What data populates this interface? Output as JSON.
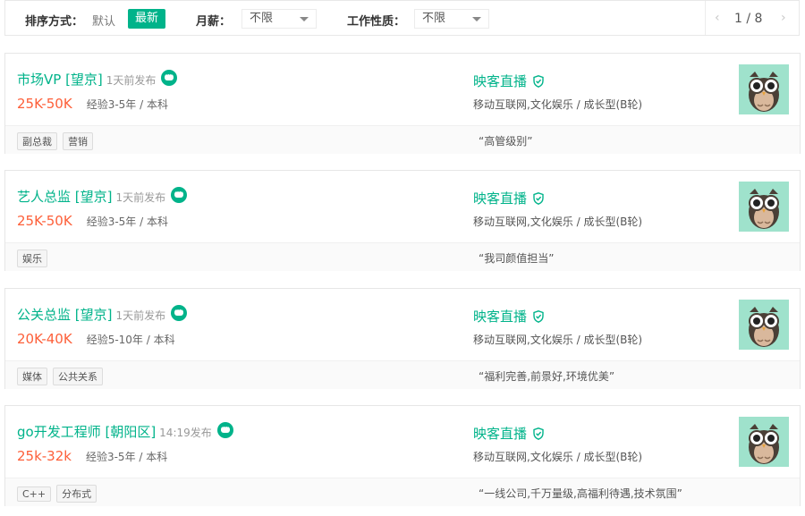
{
  "filters": {
    "sort_label": "排序方式：",
    "sort_default": "默认",
    "sort_latest": "最新",
    "salary_label": "月薪：",
    "salary_value": "不限",
    "nature_label": "工作性质：",
    "nature_value": "不限"
  },
  "pager": {
    "prev": "‹",
    "pages": "1 / 8",
    "next": "›"
  },
  "jobs": [
    {
      "position": "市场VP [望京]",
      "published": "1天前发布",
      "salary": "25K-50K",
      "requirement": "经验3-5年 / 本科",
      "company": "映客直播",
      "industry": "移动互联网,文化娱乐 / 成长型(B轮)",
      "tags": [
        "副总裁",
        "营销"
      ],
      "slogan": "“高管级别”"
    },
    {
      "position": "艺人总监 [望京]",
      "published": "1天前发布",
      "salary": "25K-50K",
      "requirement": "经验3-5年 / 本科",
      "company": "映客直播",
      "industry": "移动互联网,文化娱乐 / 成长型(B轮)",
      "tags": [
        "娱乐"
      ],
      "slogan": "“我司颜值担当”"
    },
    {
      "position": "公关总监 [望京]",
      "published": "1天前发布",
      "salary": "20K-40K",
      "requirement": "经验5-10年 / 本科",
      "company": "映客直播",
      "industry": "移动互联网,文化娱乐 / 成长型(B轮)",
      "tags": [
        "媒体",
        "公共关系"
      ],
      "slogan": "“福利完善,前景好,环境优美”"
    },
    {
      "position": "go开发工程师 [朝阳区]",
      "published": "14:19发布",
      "salary": "25k-32k",
      "requirement": "经验3-5年 / 本科",
      "company": "映客直播",
      "industry": "移动互联网,文化娱乐 / 成长型(B轮)",
      "tags": [
        "C++",
        "分布式"
      ],
      "slogan": "“一线公司,千万量级,高福利待遇,技术氛围”"
    }
  ],
  "colors": {
    "accent": "#00b38a",
    "salary": "#fd5f39",
    "logo_bg": "#9fe2cc"
  }
}
